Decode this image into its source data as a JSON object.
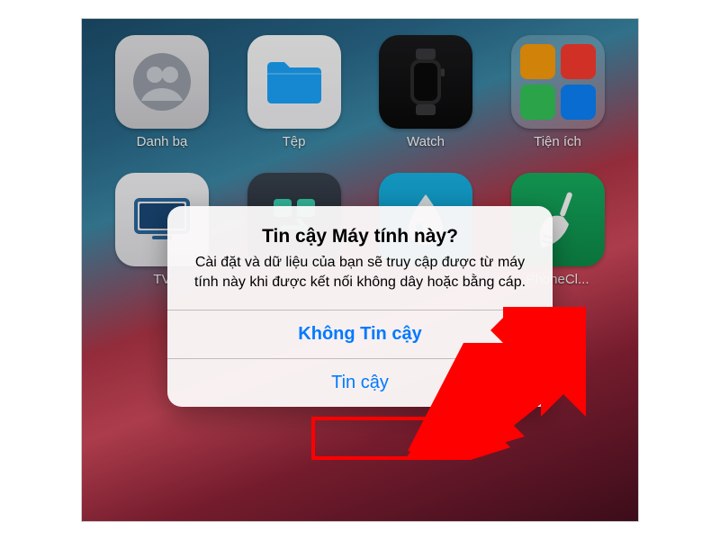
{
  "apps": {
    "contacts": "Danh bạ",
    "files": "Tệp",
    "watch": "Watch",
    "utilities": "Tiện ích",
    "tv": "TV",
    "shortcuts": "",
    "water": "",
    "phoneclean": "PhoneCl..."
  },
  "alert": {
    "title": "Tin cậy Máy tính này?",
    "message": "Cài đặt và dữ liệu của bạn sẽ truy cập được từ máy tính này khi được kết nối không dây hoặc bằng cáp.",
    "dont_trust": "Không Tin cậy",
    "trust": "Tin cậy"
  },
  "colors": {
    "ios_blue": "#007aff",
    "annotation_red": "#ff0000"
  }
}
